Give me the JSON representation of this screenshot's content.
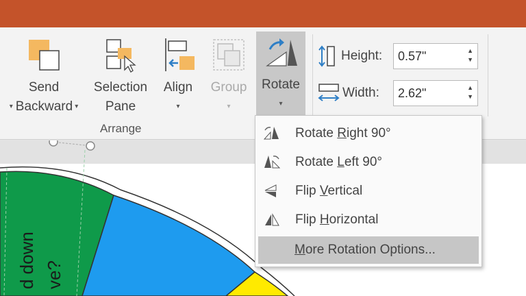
{
  "ribbon": {
    "send_backward": {
      "line1": "Send",
      "line2": "Backward"
    },
    "selection_pane": {
      "line1": "Selection",
      "line2": "Pane"
    },
    "align": {
      "label": "Align"
    },
    "group": {
      "label": "Group"
    },
    "rotate": {
      "label": "Rotate"
    },
    "arrange_group_label": "Arrange",
    "height": {
      "label": "Height:",
      "value": "0.57\""
    },
    "width": {
      "label": "Width:",
      "value": "2.62\""
    }
  },
  "rotate_menu": {
    "items": [
      {
        "pre": "Rotate ",
        "key": "R",
        "post": "ight 90°"
      },
      {
        "pre": "Rotate ",
        "key": "L",
        "post": "eft 90°"
      },
      {
        "pre": "Flip ",
        "key": "V",
        "post": "ertical"
      },
      {
        "pre": "Flip ",
        "key": "H",
        "post": "orizontal"
      }
    ],
    "more": {
      "pre": "",
      "key": "M",
      "post": "ore Rotation Options..."
    }
  },
  "slide": {
    "text_line1": "d down",
    "text_line2": "ve?"
  },
  "colors": {
    "title_bar": "#c4532a",
    "wheel_green": "#0f9a4a",
    "wheel_blue": "#1e9bef",
    "wheel_yellow": "#ffea00",
    "icon_orange": "#f4b860"
  }
}
